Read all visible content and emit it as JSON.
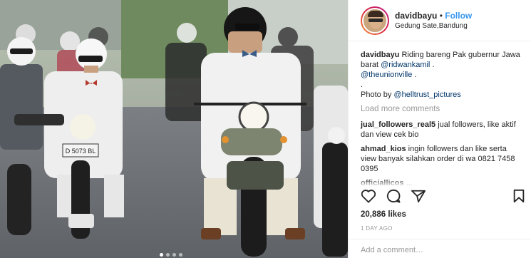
{
  "header": {
    "username": "davidbayu",
    "separator": "•",
    "follow_label": "Follow",
    "location": "Gedung Sate,Bandung"
  },
  "photo": {
    "plate_left": "D 5073 BL"
  },
  "caption": {
    "username": "davidbayu",
    "text_1": "Riding bareng Pak gubernur Jawa barat ",
    "mention_1": "@ridwankamil",
    "text_2": " .",
    "mention_2": "@theunionville",
    "text_3": " .",
    "dot": ".",
    "photo_by": "Photo by ",
    "mention_3": "@helltrust_pictures"
  },
  "load_more": "Load more comments",
  "comments": [
    {
      "user": "jual_followers_real5",
      "text": " jual followers, like aktif dan view cek bio"
    },
    {
      "user": "ahmad_kios",
      "text": " ingin followers dan like serta view banyak silahkan order di wa 0821 7458 0395"
    },
    {
      "user": "officiallicos",
      "text": " ..."
    }
  ],
  "likes": "20,886 likes",
  "time_ago": "1 DAY AGO",
  "add_comment_placeholder": "Add a comment…",
  "icons": {
    "like": "heart-icon",
    "comment": "comment-bubble-icon",
    "share": "share-icon",
    "save": "bookmark-icon"
  },
  "colors": {
    "link": "#003569",
    "follow": "#3897f0",
    "muted": "#999999"
  }
}
